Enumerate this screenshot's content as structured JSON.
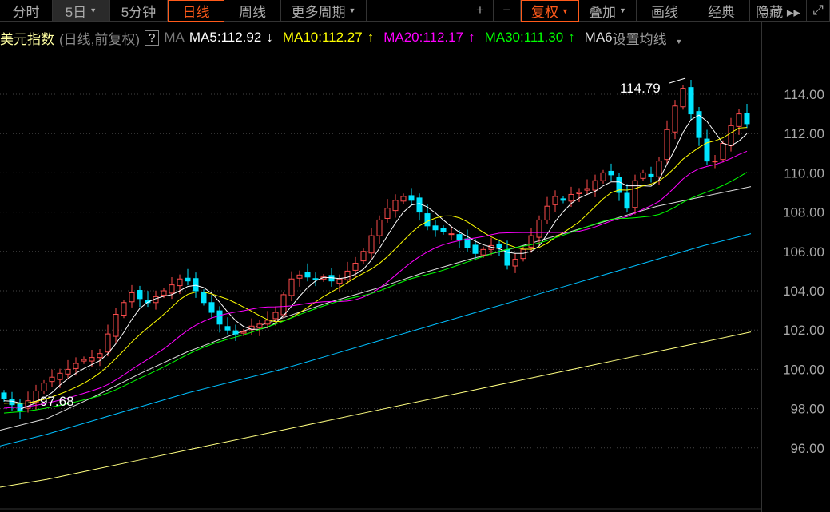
{
  "toolbar": {
    "items": [
      {
        "label": "分时",
        "state": "normal",
        "w": 66
      },
      {
        "label": "5日",
        "state": "selected",
        "dropdown": true,
        "w": 72
      },
      {
        "label": "5分钟",
        "state": "normal",
        "w": 72
      },
      {
        "label": "日线",
        "state": "active",
        "w": 71
      },
      {
        "label": "周线",
        "state": "normal",
        "w": 71
      },
      {
        "label": "更多周期",
        "state": "normal",
        "dropdown": true,
        "w": 107
      }
    ],
    "right": [
      {
        "label": "+",
        "state": "normal",
        "w": 33
      },
      {
        "label": "−",
        "state": "normal",
        "w": 34
      },
      {
        "label": "复权",
        "state": "active",
        "dropdown": true,
        "w": 73
      },
      {
        "label": "叠加",
        "state": "normal",
        "dropdown": true,
        "w": 72
      },
      {
        "label": "画线",
        "state": "normal",
        "w": 71
      },
      {
        "label": "经典",
        "state": "normal",
        "w": 71
      },
      {
        "label": "隐藏 ▸▸",
        "state": "normal",
        "w": 71
      },
      {
        "label": "⤢",
        "state": "normal",
        "w": 29
      }
    ]
  },
  "legend": {
    "name": "美元指数",
    "sub": "(日线,前复权)",
    "help": "?",
    "ma": "MA",
    "ma5": "MA5:112.92",
    "ma5_arrow": "↓",
    "ma10": "MA10:112.27",
    "ma10_arrow": "↑",
    "ma20": "MA20:112.17",
    "ma20_arrow": "↑",
    "ma30": "MA30:111.30",
    "ma30_arrow": "↑",
    "ma60": "MA6",
    "settings": "设置均线"
  },
  "colors": {
    "up": "#ff4d4d",
    "down": "#00e5ff",
    "ma5": "#ffffff",
    "ma10": "#ffff00",
    "ma20": "#ff00ff",
    "ma30": "#00ff00",
    "ma60": "#dddddd",
    "ma120": "#00bfff",
    "ma250": "#ffff80"
  },
  "chart_data": {
    "type": "candlestick",
    "ylim": [
      94,
      115.2
    ],
    "yticks": [
      "114.00",
      "112.00",
      "110.00",
      "108.00",
      "106.00",
      "104.00",
      "102.00",
      "100.00",
      "98.00",
      "96.00"
    ],
    "high_label": "114.79",
    "low_label": "97.68",
    "closes": [
      98.5,
      98.2,
      97.9,
      98.4,
      98.9,
      99.3,
      99.6,
      99.8,
      100.0,
      100.3,
      100.5,
      100.6,
      100.8,
      101.8,
      102.8,
      103.4,
      103.9,
      103.6,
      103.4,
      103.7,
      104.0,
      104.3,
      104.6,
      104.5,
      104.0,
      103.4,
      102.9,
      102.3,
      102.0,
      101.8,
      101.9,
      102.2,
      102.3,
      102.5,
      102.9,
      103.8,
      104.6,
      104.8,
      104.7,
      104.6,
      104.7,
      104.5,
      104.6,
      105.0,
      105.4,
      106.0,
      106.8,
      107.6,
      108.2,
      108.6,
      108.8,
      108.6,
      108.0,
      107.3,
      107.1,
      107.0,
      106.9,
      106.6,
      106.2,
      105.9,
      106.1,
      106.3,
      106.2,
      105.3,
      105.6,
      106.1,
      106.8,
      107.6,
      108.3,
      108.8,
      108.6,
      108.9,
      109.0,
      109.2,
      109.6,
      110.0,
      109.9,
      109.0,
      108.2,
      109.6,
      110.0,
      109.8,
      110.6,
      112.2,
      113.4,
      114.3,
      113.0,
      111.8,
      110.6,
      110.6,
      111.5,
      112.4,
      113.0,
      112.5
    ],
    "long_ma": {
      "ma60": [
        96.9,
        97.5,
        98.6,
        99.8,
        100.9,
        101.8,
        102.6,
        103.4,
        104.1,
        104.9,
        105.6,
        106.2,
        106.9,
        107.6,
        108.3,
        108.8,
        109.3
      ],
      "ma120": [
        96.1,
        96.7,
        97.4,
        98.1,
        98.8,
        99.4,
        100.0,
        100.7,
        101.4,
        102.1,
        102.8,
        103.5,
        104.2,
        104.9,
        105.6,
        106.3,
        106.9
      ],
      "ma250": [
        94.0,
        94.4,
        94.9,
        95.4,
        95.9,
        96.4,
        96.9,
        97.4,
        97.9,
        98.4,
        98.9,
        99.4,
        99.9,
        100.4,
        100.9,
        101.4,
        101.9
      ]
    }
  }
}
